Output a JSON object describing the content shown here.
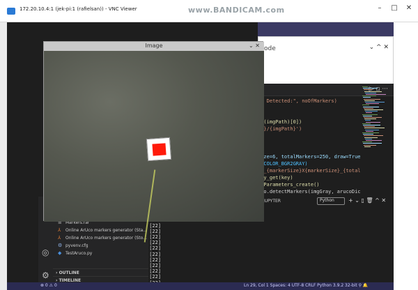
{
  "vnc": {
    "title": "172.20.10.4:1 (jek-pi:1 (rafielsan)) - VNC Viewer",
    "watermark": "www.BANDICAM.com",
    "minimize": "–",
    "maximize": "□",
    "close": "✕"
  },
  "dialog": {
    "title": "ode",
    "controls": "⌄  ^  ✕"
  },
  "editor": {
    "controls": "▷  ▫  ···",
    "code_lines": [
      {
        "text": "rs Detected:\", noOfMarkers)",
        "color": "#ce9178"
      },
      {
        "text": "",
        "color": "#d4d4d4"
      },
      {
        "text": "",
        "color": "#d4d4d4"
      },
      {
        "text": "xt(imgPath)[0])",
        "color": "#dcdcaa"
      },
      {
        "text": "th}/{imgPath}')",
        "color": "#ce9178"
      },
      {
        "text": "",
        "color": "#d4d4d4"
      },
      {
        "text": "",
        "color": "#d4d4d4"
      },
      {
        "text": "",
        "color": "#d4d4d4"
      },
      {
        "text": "Size=6, totalMarkers=250, draw=True",
        "color": "#9cdcfe"
      },
      {
        "text": "v.COLOR_BGR2GRAY)",
        "color": "#4fc1ff"
      },
      {
        "text": "CT_{markerSize}X{markerSize}_{total",
        "color": "#ce9178"
      },
      {
        "text": "ary_get(key)",
        "color": "#dcdcaa"
      },
      {
        "text": "orParameters_create()",
        "color": "#dcdcaa"
      },
      {
        "text": "uco.detectMarkers(imgGray, arucoDic",
        "color": "#d4d4d4"
      }
    ]
  },
  "panel": {
    "jupyter": "JUPYTER",
    "python_tab": "Python",
    "controls": "+ ⌄  ▯  🗑  ^  ✕"
  },
  "terminal": {
    "lines": [
      "[22]",
      "[[22]",
      "[[22]",
      "[[22]",
      "[[22]",
      "[[22]",
      "[[22]",
      "[[22]",
      "[[22]",
      "[[22]",
      "[[22]",
      "[[22]",
      "[[22]",
      "[[22]",
      "[]"
    ]
  },
  "sidebar": {
    "files": [
      {
        "name": "Markers.rar",
        "icon": "≡",
        "color": "#c5c5c5"
      },
      {
        "name": "Online ArUco markers generator (Sta...",
        "icon": "⅄",
        "color": "#e8823a"
      },
      {
        "name": "Online ArUco markers generator (Sto...",
        "icon": "⅄",
        "color": "#e8823a"
      },
      {
        "name": "pyvenv.cfg",
        "icon": "⚙",
        "color": "#8fb3e8"
      },
      {
        "name": "TestAruco.py",
        "icon": "◆",
        "color": "#4a8fdb"
      }
    ],
    "outline": "OUTLINE",
    "timeline": "TIMELINE"
  },
  "statusbar": {
    "left": "⊗ 0 ⚠ 0",
    "right": "Ln 29, Col 1    Spaces: 4    UTF-8    CRLF    Python    3.9.2 32-bit    ⚲    🔔"
  },
  "image_window": {
    "title": "Image",
    "controls": "⌄  ✕"
  },
  "colors": {
    "status_bar": "#2b2b52",
    "marker_red": "#ff1a0a",
    "vscode_bg": "#1e1e1e"
  }
}
